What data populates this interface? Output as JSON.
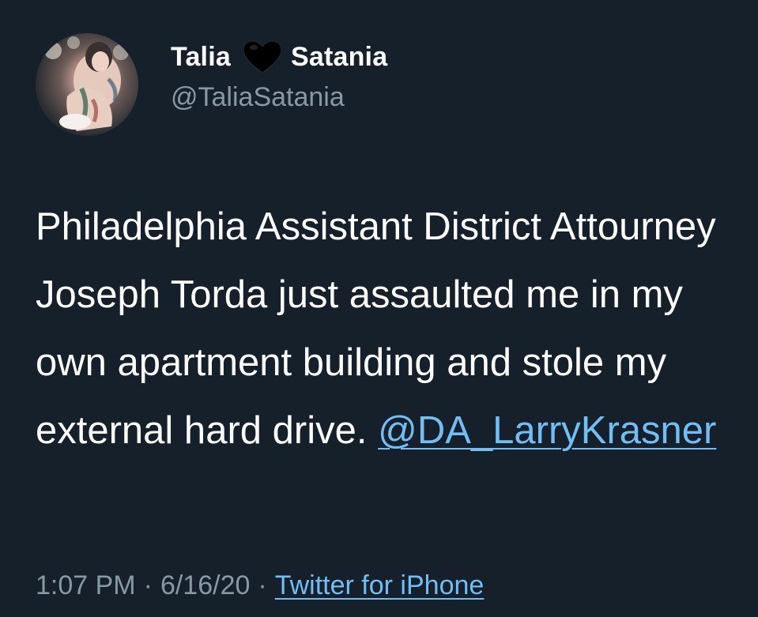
{
  "author": {
    "first_name": "Talia",
    "heart_icon": "black-heart-icon",
    "last_name": "Satania",
    "handle": "@TaliaSatania",
    "avatar": "profile-photo"
  },
  "tweet": {
    "text": "Philadelphia Assistant District Attourney Joseph Torda just assaulted me in my own apartment building and stole my external hard drive.",
    "mention": "@DA_LarryKrasner"
  },
  "meta": {
    "time": "1:07 PM",
    "separator": "·",
    "date": "6/16/20",
    "source": "Twitter for iPhone"
  },
  "colors": {
    "background": "#15202b",
    "text": "#ffffff",
    "secondary": "#8899a6",
    "link": "#71bdf4"
  }
}
